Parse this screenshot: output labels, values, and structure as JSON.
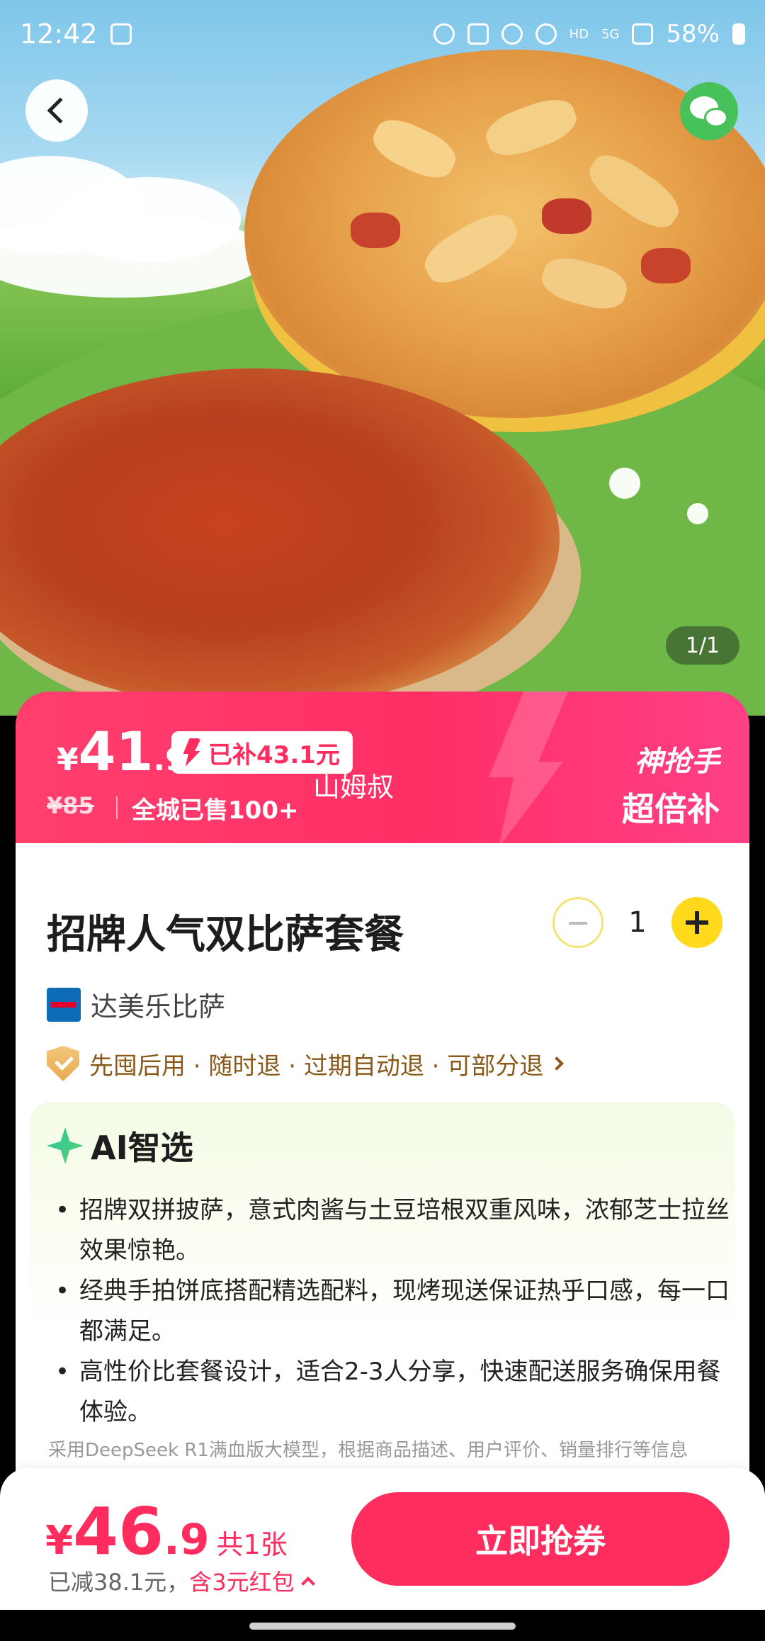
{
  "status_bar": {
    "time": "12:42",
    "battery": "58%",
    "net_hd": "HD",
    "net_5g": "5G"
  },
  "gallery": {
    "pager": "1/1"
  },
  "price_banner": {
    "currency": "¥",
    "price_int": "41",
    "price_dec": ".9",
    "subsidy": "已补43.1元",
    "original_price": "¥85",
    "sold": "全城已售100+",
    "overlay_text": "山姆叔",
    "badge_top": "神抢手",
    "badge_bottom": "超倍补"
  },
  "product": {
    "title": "招牌人气双比萨套餐",
    "quantity": "1",
    "store_name": "达美乐比萨",
    "policy": "先囤后用 · 随时退 · 过期自动退 · 可部分退"
  },
  "ai": {
    "title": "AI智选",
    "items": [
      "招牌双拼披萨，意式肉酱与土豆培根双重风味，浓郁芝士拉丝效果惊艳。",
      "经典手拍饼底搭配精选配料，现烤现送保证热乎口感，每一口都满足。",
      "高性价比套餐设计，适合2-3人分享，快速配送服务确保用餐体验。"
    ],
    "disclaimer": "采用DeepSeek R1满血版大模型，根据商品描述、用户评价、销量排行等信息"
  },
  "bottom_bar": {
    "currency": "¥",
    "total_int": "46",
    "total_dec": ".9",
    "count": "共1张",
    "savings_prefix": "已减38.1元，",
    "savings_red": "含3元红包",
    "buy_label": "立即抢券"
  },
  "colors": {
    "accent": "#ff2c5e",
    "plus_button": "#ffd91c",
    "wechat": "#47c15a"
  }
}
